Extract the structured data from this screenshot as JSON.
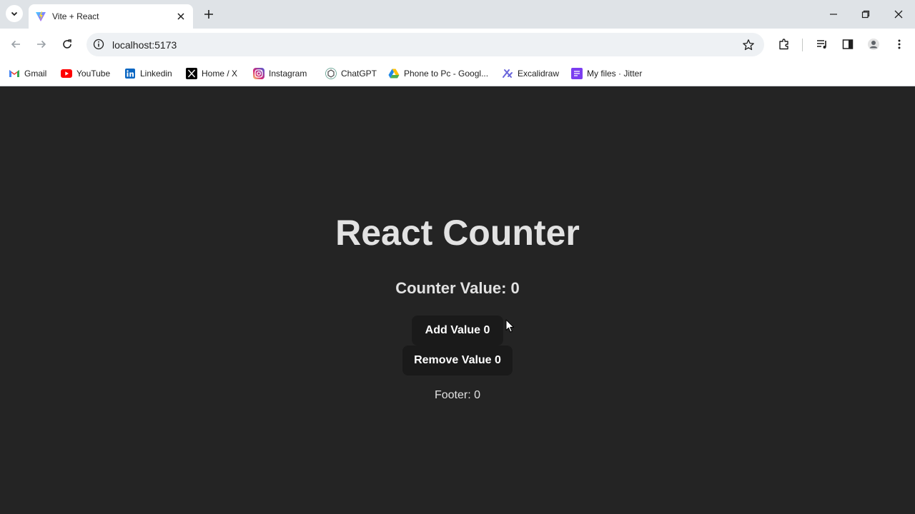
{
  "browser": {
    "tab": {
      "title": "Vite + React"
    },
    "address": {
      "url": "localhost:5173"
    },
    "bookmarks": [
      {
        "label": "Gmail",
        "icon": "gmail-icon"
      },
      {
        "label": "YouTube",
        "icon": "youtube-icon"
      },
      {
        "label": "Linkedin",
        "icon": "linkedin-icon"
      },
      {
        "label": "Home / X",
        "icon": "x-icon"
      },
      {
        "label": "Instagram",
        "icon": "instagram-icon"
      },
      {
        "label": "ChatGPT",
        "icon": "chatgpt-icon"
      },
      {
        "label": "Phone to Pc - Googl...",
        "icon": "google-drive-icon"
      },
      {
        "label": "Excalidraw",
        "icon": "excalidraw-icon"
      },
      {
        "label": "My files · Jitter",
        "icon": "jitter-icon"
      }
    ]
  },
  "app": {
    "title": "React Counter",
    "counter_label": "Counter Value: 0",
    "add_button": "Add Value 0",
    "remove_button": "Remove Value 0",
    "footer": "Footer: 0"
  },
  "colors": {
    "page_background": "#242424",
    "button_background": "#1a1a1a",
    "text": "#ffffff"
  }
}
